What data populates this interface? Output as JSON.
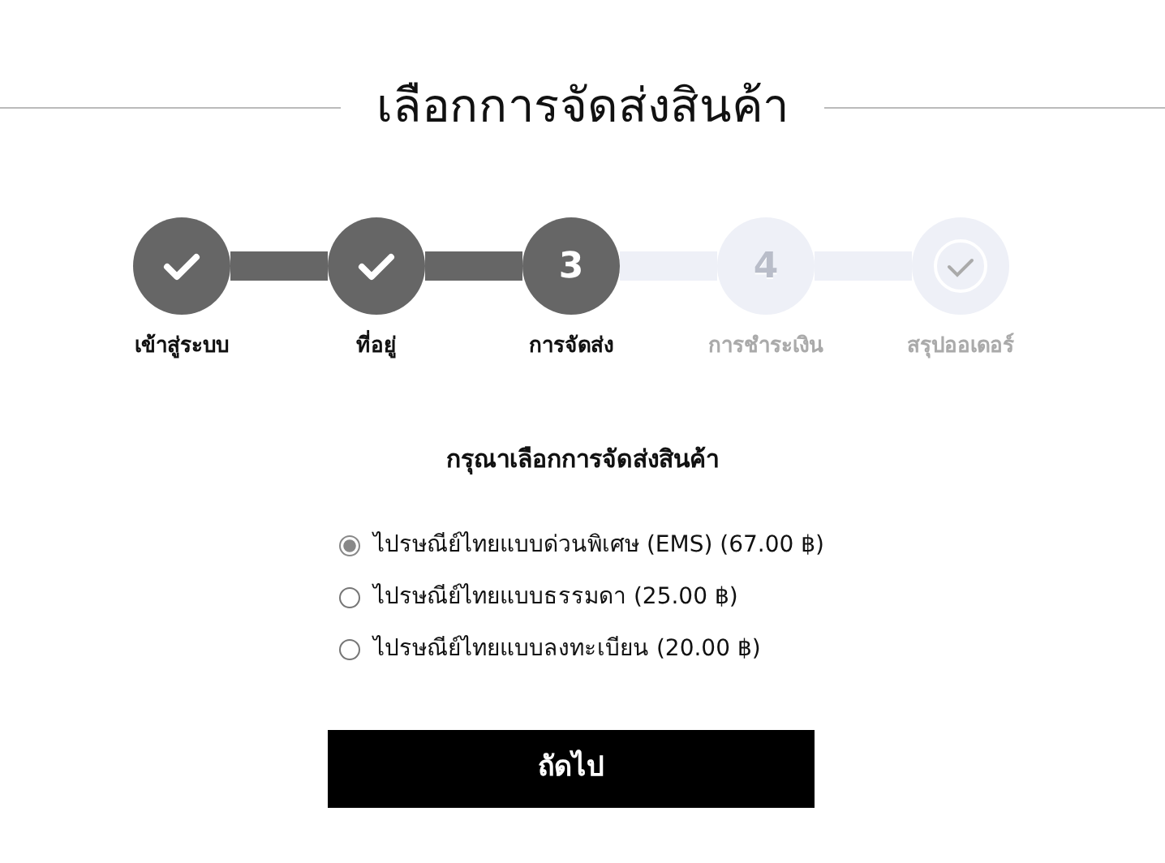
{
  "title": "เลือกการจัดส่งสินค้า",
  "steps": [
    {
      "label": "เข้าสู่ระบบ",
      "reached": true,
      "kind": "check"
    },
    {
      "label": "ที่อยู่",
      "reached": true,
      "kind": "check"
    },
    {
      "label": "การจัดส่ง",
      "reached": true,
      "kind": "number",
      "number": "3"
    },
    {
      "label": "การชำระเงิน",
      "reached": false,
      "kind": "number",
      "number": "4"
    },
    {
      "label": "สรุปออเดอร์",
      "reached": false,
      "kind": "check"
    }
  ],
  "prompt": "กรุณาเลือกการจัดส่งสินค้า",
  "options": [
    {
      "label": "ไปรษณีย์ไทยแบบด่วนพิเศษ (EMS) (67.00 ฿)",
      "selected": true
    },
    {
      "label": "ไปรษณีย์ไทยแบบธรรมดา (25.00 ฿)",
      "selected": false
    },
    {
      "label": "ไปรษณีย์ไทยแบบลงทะเบียน (20.00 ฿)",
      "selected": false
    }
  ],
  "next_button": "ถัดไป"
}
